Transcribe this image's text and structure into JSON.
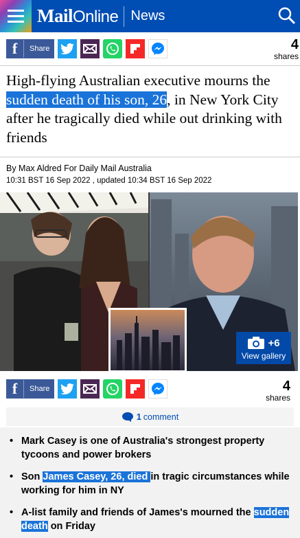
{
  "header": {
    "logo_mail": "Mail",
    "logo_online": "Online",
    "section": "News"
  },
  "share_top": {
    "share_label": "Share",
    "count": "4",
    "count_label": "shares"
  },
  "article": {
    "headline_1": "High-flying Australian executive mourns the ",
    "headline_highlight": "sudden death of his son, 26",
    "headline_2": ", in New York City after he tragically died while out drinking with friends",
    "byline": "By Max Aldred For Daily Mail Australia",
    "dates": "10:31 BST 16 Sep 2022 , updated 10:34 BST 16 Sep 2022"
  },
  "gallery": {
    "count": "+6",
    "label": "View gallery"
  },
  "share_bottom": {
    "share_label": "Share",
    "count": "4",
    "count_label": "shares"
  },
  "comments": {
    "count": "1",
    "label": "comment"
  },
  "bullets": [
    {
      "text": "Mark Casey is one of Australia's strongest property tycoons and power brokers"
    },
    {
      "pre": "Son ",
      "highlight": "James Casey, 26, died ",
      "post": "in tragic circumstances while working for him in NY"
    },
    {
      "pre": "A-list family and friends of James's mourned the ",
      "highlight": "sudden death",
      "post": " on Friday"
    }
  ],
  "colors": {
    "brand_blue": "#004db3",
    "highlight": "#1a73d9"
  }
}
